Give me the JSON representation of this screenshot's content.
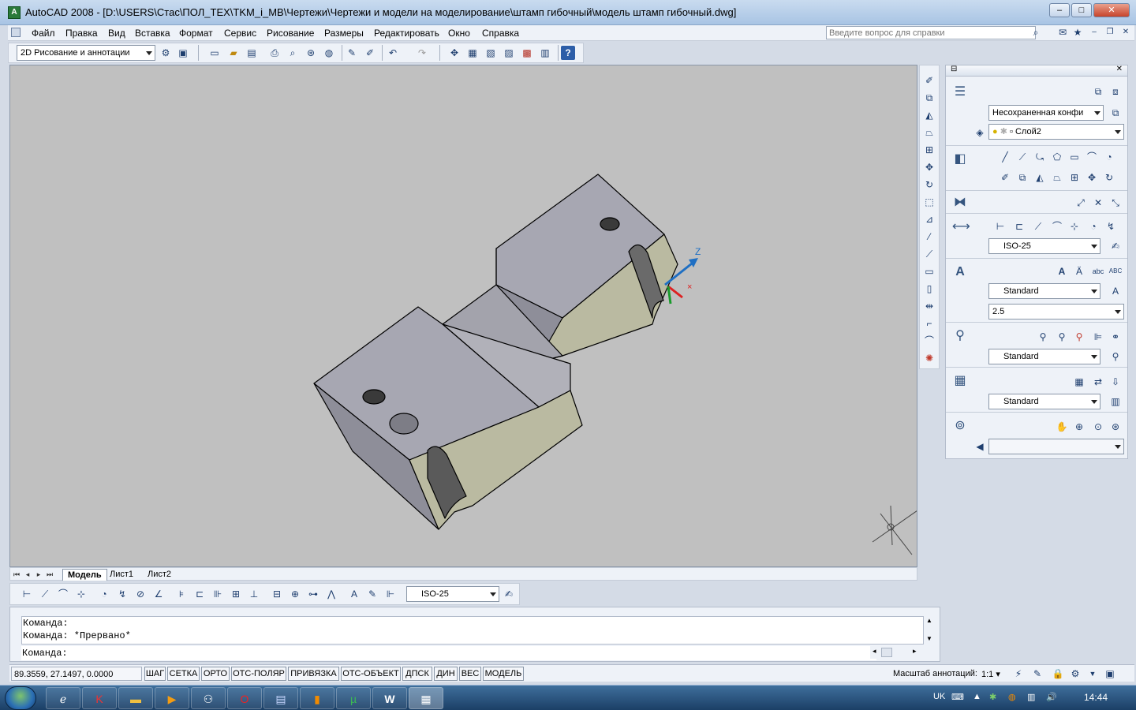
{
  "window": {
    "title": "AutoCAD 2008 - [D:\\USERS\\Стас\\ПОЛ_ТЕХ\\TKM_i_MB\\Чертежи\\Чертежи и модели на моделирование\\штамп гибочный\\модель штамп гибочный.dwg]",
    "app_icon": "autocad-icon"
  },
  "menu": {
    "items": [
      "Файл",
      "Правка",
      "Вид",
      "Вставка",
      "Формат",
      "Сервис",
      "Рисование",
      "Размеры",
      "Редактировать",
      "Окно",
      "Справка"
    ],
    "help_placeholder": "Введите вопрос для справки"
  },
  "toolbar": {
    "workspace": "2D Рисование и аннотации"
  },
  "layout_tabs": [
    "Модель",
    "Лист1",
    "Лист2"
  ],
  "ucs": {
    "z_label": "Z"
  },
  "dim_toolbar": {
    "style": "ISO-25"
  },
  "palette": {
    "layer_state": "Несохраненная конфи",
    "layer": "Слой2",
    "dim_style": "ISO-25",
    "text_style": "Standard",
    "text_height": "2.5",
    "mleader_style": "Standard",
    "table_style": "Standard"
  },
  "command": {
    "lines": [
      "Команда:",
      "Команда: *Прервано*"
    ],
    "prompt": "Команда:"
  },
  "status": {
    "coords": "89.3559, 27.1497, 0.0000",
    "buttons": [
      "ШАГ",
      "СЕТКА",
      "ОРТО",
      "ОТС-ПОЛЯР",
      "ПРИВЯЗКА",
      "ОТС-ОБЪЕКТ",
      "ДПСК",
      "ДИН",
      "ВЕС",
      "МОДЕЛЬ"
    ],
    "annotation_scale_label": "Масштаб аннотаций:",
    "annotation_scale": "1:1"
  },
  "taskbar": {
    "lang": "UK",
    "time": "14:44"
  }
}
